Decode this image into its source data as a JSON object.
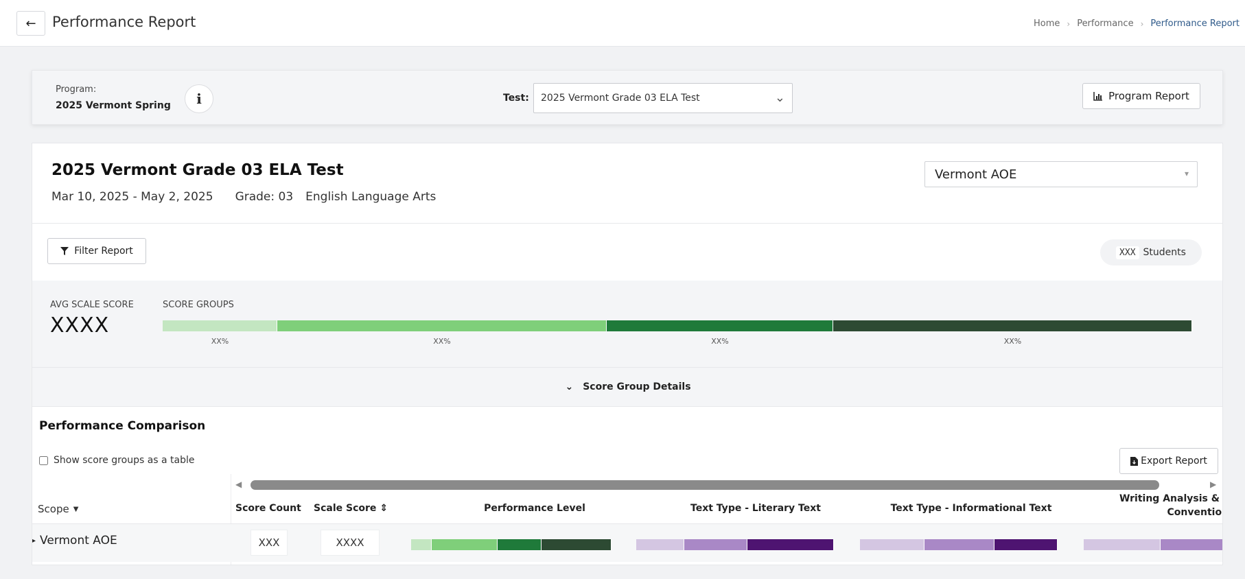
{
  "header": {
    "title": "Performance Report",
    "breadcrumb": [
      "Home",
      "Performance",
      "Performance Report"
    ]
  },
  "program": {
    "label": "Program:",
    "value": "2025 Vermont Spring",
    "test_label": "Test:",
    "test_value": "2025 Vermont Grade 03 ELA Test",
    "program_report_label": "Program Report"
  },
  "report": {
    "title": "2025 Vermont Grade 03 ELA Test",
    "date_range": "Mar 10, 2025 - May 2, 2025",
    "grade": "Grade: 03",
    "subject": "English Language Arts",
    "org_select": "Vermont AOE",
    "filter_label": "Filter Report",
    "students_count": "XXX",
    "students_label": "Students",
    "avg_scale_label": "AVG SCALE SCORE",
    "avg_scale_value": "XXXX",
    "score_groups_label": "SCORE GROUPS",
    "score_groups": [
      {
        "label": "XX%",
        "color": "#c3e6c1"
      },
      {
        "label": "XX%",
        "color": "#7fcf7a"
      },
      {
        "label": "XX%",
        "color": "#1f7a3a"
      },
      {
        "label": "XX%",
        "color": "#2d4a33"
      }
    ],
    "details_label": "Score Group Details"
  },
  "comparison": {
    "title": "Performance Comparison",
    "show_table_label": "Show score groups as a table",
    "export_label": "Export Report",
    "columns": {
      "scope": "Scope",
      "score_count": "Score Count",
      "scale_score": "Scale Score",
      "performance_level": "Performance Level",
      "literary": "Text Type - Literary Text",
      "informational": "Text Type - Informational Text",
      "writing_line1": "Writing Analysis & I",
      "writing_line2": "Conventior"
    },
    "row": {
      "scope": "Vermont AOE",
      "score_count": "XXX",
      "scale_score": "XXXX"
    },
    "colors": {
      "green": [
        "#c3e6c1",
        "#7fcf7a",
        "#1f7a3a",
        "#2d4a33"
      ],
      "purple": [
        "#d4c6e2",
        "#a988c6",
        "#4e1471"
      ]
    }
  }
}
